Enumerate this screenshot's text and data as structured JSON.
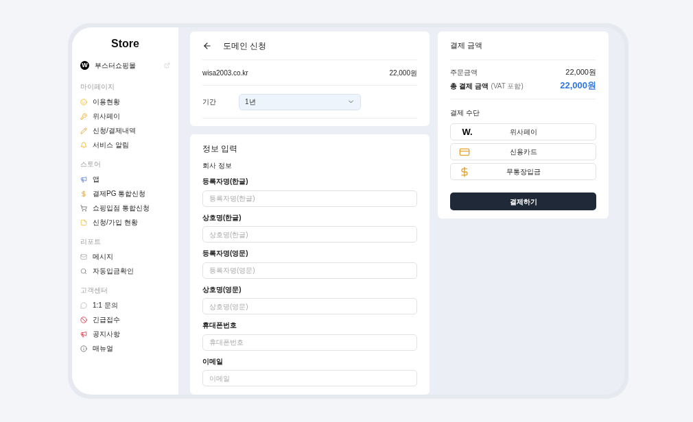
{
  "sidebar": {
    "logo": "Store",
    "shop": {
      "badge": "W",
      "name": "부스터쇼핑몰"
    },
    "sections": [
      {
        "title": "마이페이지",
        "items": [
          {
            "label": "이용현황"
          },
          {
            "label": "위사페이"
          },
          {
            "label": "신청/결제내역"
          },
          {
            "label": "서비스 알림"
          }
        ]
      },
      {
        "title": "스토어",
        "items": [
          {
            "label": "앱"
          },
          {
            "label": "결제PG 통합신청"
          },
          {
            "label": "쇼핑입점 통합신청"
          },
          {
            "label": "신청/가입 현황"
          }
        ]
      },
      {
        "title": "리포트",
        "items": [
          {
            "label": "메시지"
          },
          {
            "label": "자동입금확인"
          }
        ]
      },
      {
        "title": "고객센터",
        "items": [
          {
            "label": "1:1 문의"
          },
          {
            "label": "긴급접수"
          },
          {
            "label": "공지사항"
          },
          {
            "label": "매뉴얼"
          }
        ]
      }
    ]
  },
  "domain": {
    "title": "도메인 신청",
    "name": "wisa2003.co.kr",
    "price": "22,000원",
    "period_label": "기간",
    "period_value": "1년"
  },
  "info": {
    "title": "정보 입력",
    "section": "회사 정보",
    "fields": [
      {
        "label": "등록자명(한글)",
        "placeholder": "등록자명(한글)"
      },
      {
        "label": "상호명(한글)",
        "placeholder": "상호명(한글)"
      },
      {
        "label": "등록자명(영문)",
        "placeholder": "등록자명(영문)"
      },
      {
        "label": "상호명(영문)",
        "placeholder": "상호명(영문)"
      },
      {
        "label": "휴대폰번호",
        "placeholder": "휴대폰번호"
      },
      {
        "label": "이메일",
        "placeholder": "이메일"
      }
    ]
  },
  "payment": {
    "title": "결제 금액",
    "order_label": "주문금액",
    "order_value": "22,000원",
    "total_label": "총 결제 금액",
    "total_note": "(VAT 포함)",
    "total_value": "22,000원",
    "methods_title": "결제 수단",
    "methods": [
      {
        "kind": "logo",
        "logo": "W.",
        "label": "위사페이"
      },
      {
        "kind": "card",
        "label": "신용카드"
      },
      {
        "kind": "money",
        "label": "무통장입금"
      }
    ],
    "submit": "결제하기"
  }
}
